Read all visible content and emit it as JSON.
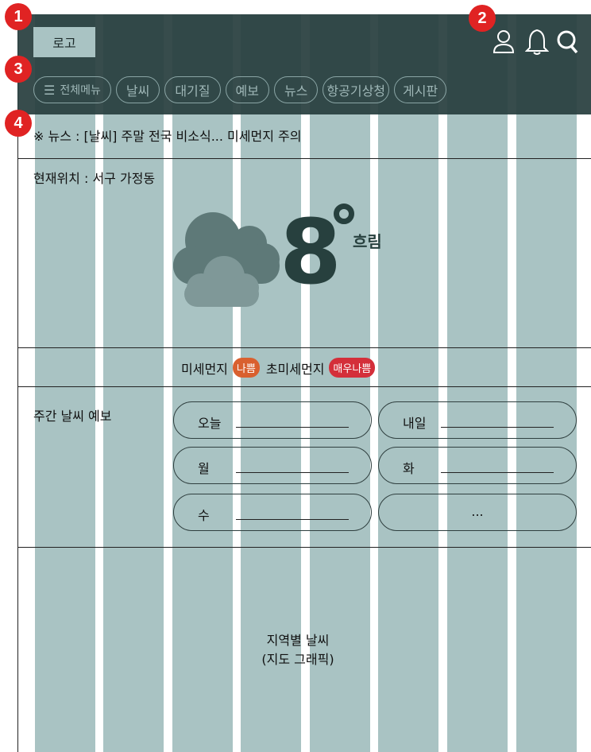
{
  "header": {
    "logo_label": "로고",
    "icons": [
      "user-icon",
      "bell-icon",
      "search-icon"
    ],
    "bg_color": "#2c4544"
  },
  "markers": [
    "1",
    "2",
    "3",
    "4"
  ],
  "nav": {
    "items": [
      "전체메뉴",
      "날씨",
      "대기질",
      "예보",
      "뉴스",
      "항공기상청",
      "게시판"
    ]
  },
  "news": {
    "text": "※ 뉴스 : [날씨] 주말 전국 비소식... 미세먼지 주의"
  },
  "weather": {
    "location": "현재위치 : 서구 가정동",
    "temperature": "8",
    "condition": "흐림",
    "icon": "cloudy-icon"
  },
  "air_quality": {
    "pm10_label": "미세먼지",
    "pm10_status": "나쁨",
    "pm10_color": "#d9602f",
    "pm25_label": "초미세먼지",
    "pm25_status": "매우나쁨",
    "pm25_color": "#d42f3a"
  },
  "weekly": {
    "title": "주간 날씨 예보",
    "days": [
      "오늘",
      "내일",
      "월",
      "화",
      "수"
    ],
    "more": "..."
  },
  "map": {
    "title": "지역별 날씨",
    "subtitle": "(지도 그래픽)"
  },
  "colors": {
    "grid_column": "#a9c3c3",
    "accent_dark": "#27403e",
    "marker": "#e02323"
  }
}
